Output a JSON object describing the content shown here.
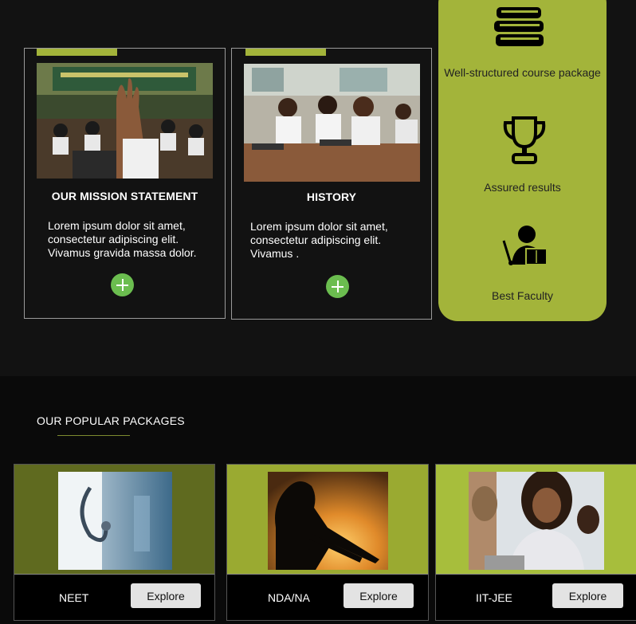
{
  "cards": [
    {
      "title": "OUR MISSION STATEMENT",
      "text": "Lorem ipsum dolor sit amet, consectetur adipiscing elit. Vivamus gravida massa dolor."
    },
    {
      "title": "HISTORY",
      "text": "Lorem ipsum dolor sit amet, consectetur adipiscing elit. Vivamus ."
    }
  ],
  "features": [
    {
      "label": "Well-structured course package",
      "icon": "books-icon"
    },
    {
      "label": "Assured results",
      "icon": "trophy-icon"
    },
    {
      "label": "Best Faculty",
      "icon": "teacher-icon"
    }
  ],
  "packages_section": {
    "title": "OUR POPULAR PACKAGES"
  },
  "packages": [
    {
      "name": "NEET",
      "button": "Explore",
      "image": "doctor-stethoscope-image"
    },
    {
      "name": "NDA/NA",
      "button": "Explore",
      "image": "soldier-silhouette-image"
    },
    {
      "name": "IIT-JEE",
      "button": "Explore",
      "image": "students-laughing-image"
    }
  ],
  "colors": {
    "accent": "#a3b43a",
    "plus": "#6bbd4f",
    "background": "#121212"
  }
}
